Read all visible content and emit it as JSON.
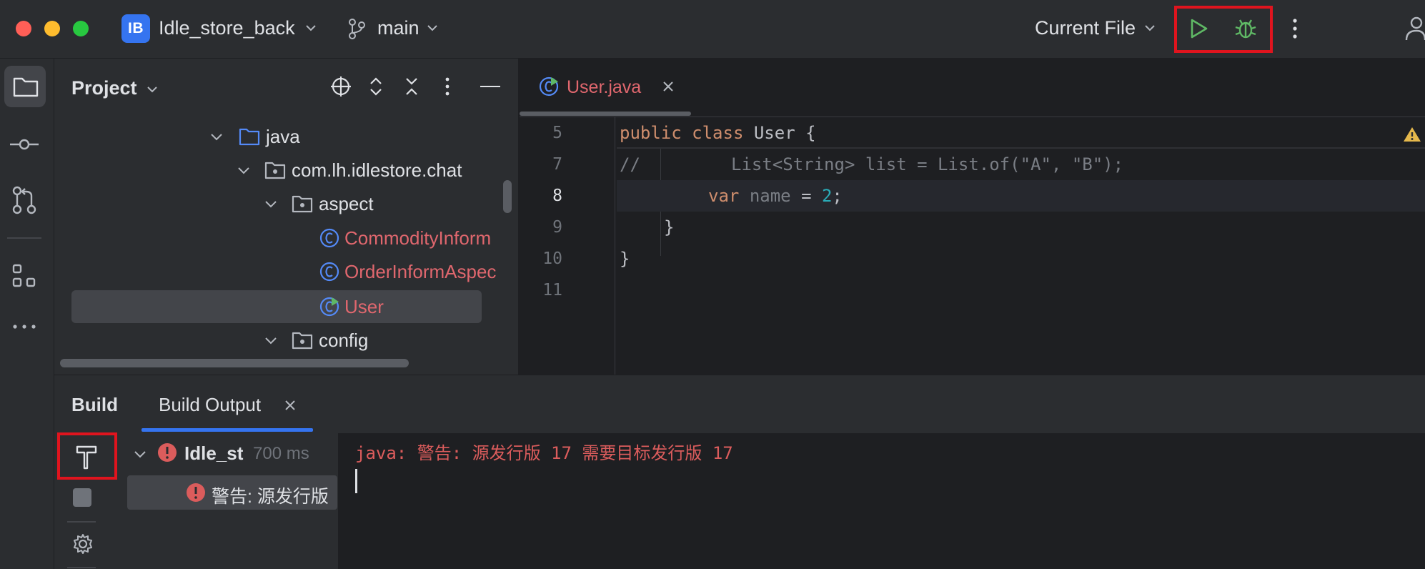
{
  "titlebar": {
    "project_badge": "IB",
    "project_name": "Idle_store_back",
    "branch": "main",
    "run_config": "Current File",
    "icons": [
      "folder-icon",
      "commit-icon",
      "pull-request-icon",
      "structure-icon",
      "more-icon"
    ]
  },
  "project_panel": {
    "title": "Project",
    "tree": [
      {
        "label": "java",
        "type": "folder"
      },
      {
        "label": "com.lh.idlestore.chat",
        "type": "package"
      },
      {
        "label": "aspect",
        "type": "package"
      },
      {
        "label": "CommodityInform",
        "type": "class"
      },
      {
        "label": "OrderInformAspec",
        "type": "class"
      },
      {
        "label": "User",
        "type": "class-runnable"
      },
      {
        "label": "config",
        "type": "package"
      }
    ]
  },
  "editor": {
    "tab_label": "User.java",
    "lines": [
      {
        "num": "5",
        "code": "public class User {"
      },
      {
        "num": "7",
        "code": "//        List<String> list = List.of(\"A\", \"B\");"
      },
      {
        "num": "8",
        "code": "    var name = 2;"
      },
      {
        "num": "9",
        "code": "}"
      },
      {
        "num": "10",
        "code": "}"
      },
      {
        "num": "11",
        "code": ""
      }
    ],
    "tokens": {
      "kw_public": "public",
      "kw_class": "class",
      "cls_user": "User",
      "brace_open": "{",
      "comment_slash": "//",
      "comment_body": "List<String> list = List.of(\"A\", \"B\");",
      "kw_var": "var",
      "ident_name": "name",
      "op_eq": "=",
      "num_2": "2",
      "semi": ";",
      "brace_close": "}"
    }
  },
  "build": {
    "title": "Build",
    "tab": "Build Output",
    "root_item": "Idle_st",
    "root_time": "700 ms",
    "child_item": "警告: 源发行版",
    "output_line": "java: 警告: 源发行版 17 需要目标发行版 17"
  },
  "colors": {
    "accent": "#3574f0",
    "error": "#db5c5c",
    "highlight_box": "#e0141e",
    "run_green": "#5fb865"
  }
}
